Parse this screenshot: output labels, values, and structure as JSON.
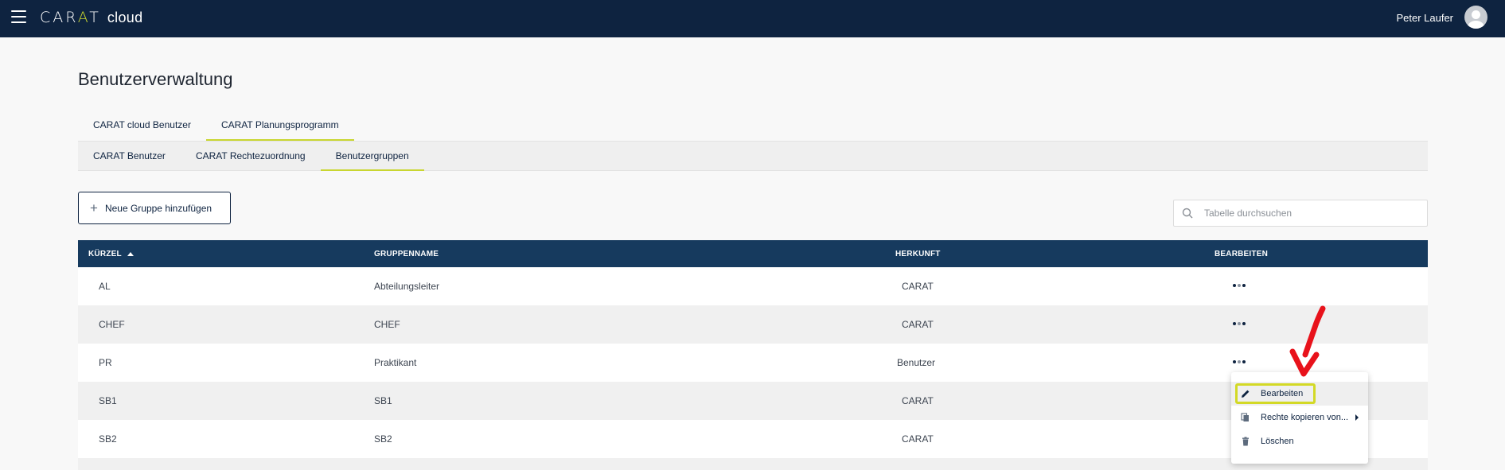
{
  "header": {
    "logo_brand": "CARAT",
    "logo_suffix": "cloud",
    "user_name": "Peter Laufer"
  },
  "page": {
    "title": "Benutzerverwaltung"
  },
  "tabs_primary": [
    {
      "label": "CARAT cloud Benutzer",
      "active": false
    },
    {
      "label": "CARAT Planungsprogramm",
      "active": true
    }
  ],
  "tabs_secondary": [
    {
      "label": "CARAT Benutzer",
      "active": false
    },
    {
      "label": "CARAT Rechtezuordnung",
      "active": false
    },
    {
      "label": "Benutzergruppen",
      "active": true
    }
  ],
  "toolbar": {
    "add_label": "Neue Gruppe hinzufügen",
    "search_placeholder": "Tabelle durchsuchen"
  },
  "table": {
    "columns": [
      "KÜRZEL",
      "GRUPPENNAME",
      "HERKUNFT",
      "BEARBEITEN"
    ],
    "sort_column": "KÜRZEL",
    "sort_direction": "asc",
    "rows": [
      {
        "kuerzel": "AL",
        "gruppenname": "Abteilungsleiter",
        "herkunft": "CARAT"
      },
      {
        "kuerzel": "CHEF",
        "gruppenname": "CHEF",
        "herkunft": "CARAT"
      },
      {
        "kuerzel": "PR",
        "gruppenname": "Praktikant",
        "herkunft": "Benutzer"
      },
      {
        "kuerzel": "SB1",
        "gruppenname": "SB1",
        "herkunft": "CARAT"
      },
      {
        "kuerzel": "SB2",
        "gruppenname": "SB2",
        "herkunft": "CARAT"
      }
    ]
  },
  "context_menu": {
    "items": [
      {
        "label": "Bearbeiten",
        "icon": "pencil-icon",
        "highlighted": true
      },
      {
        "label": "Rechte kopieren von...",
        "icon": "copy-icon",
        "has_submenu": true
      },
      {
        "label": "Löschen",
        "icon": "trash-icon"
      }
    ]
  },
  "colors": {
    "topbar": "#0e2340",
    "table_header": "#163a5e",
    "accent": "#c9d630",
    "annotation_arrow": "#e8121b"
  }
}
